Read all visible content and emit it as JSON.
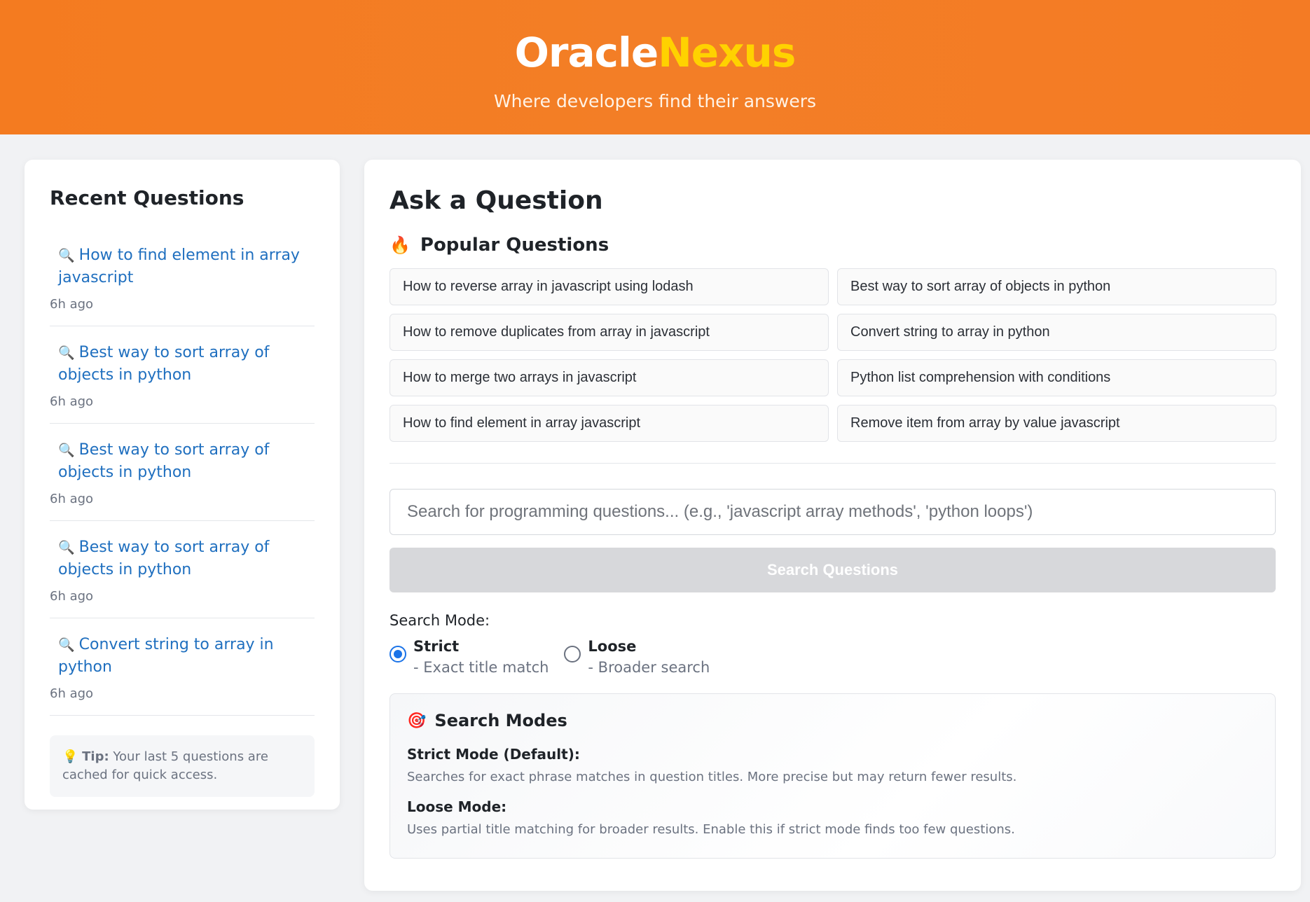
{
  "header": {
    "brand_part1": "Oracle",
    "brand_part2": "Nexus",
    "tagline": "Where developers find their answers"
  },
  "sidebar": {
    "title": "Recent Questions",
    "items": [
      {
        "label": "How to find element in array javascript",
        "time": "6h ago"
      },
      {
        "label": "Best way to sort array of objects in python",
        "time": "6h ago"
      },
      {
        "label": "Best way to sort array of objects in python",
        "time": "6h ago"
      },
      {
        "label": "Best way to sort array of objects in python",
        "time": "6h ago"
      },
      {
        "label": "Convert string to array in python",
        "time": "6h ago"
      }
    ],
    "tip_label": "Tip:",
    "tip_text": "Your last 5 questions are cached for quick access."
  },
  "main": {
    "title": "Ask a Question",
    "popular_title": "Popular Questions",
    "popular": [
      "How to reverse array in javascript using lodash",
      "Best way to sort array of objects in python",
      "How to remove duplicates from array in javascript",
      "Convert string to array in python",
      "How to merge two arrays in javascript",
      "Python list comprehension with conditions",
      "How to find element in array javascript",
      "Remove item from array by value javascript"
    ],
    "search_placeholder": "Search for programming questions... (e.g., 'javascript array methods', 'python loops')",
    "search_value": "",
    "search_button": "Search Questions",
    "mode_label": "Search Mode:",
    "modes": [
      {
        "name": "Strict",
        "desc": "- Exact title match",
        "selected": true
      },
      {
        "name": "Loose",
        "desc": "- Broader search",
        "selected": false
      }
    ],
    "info": {
      "title": "Search Modes",
      "strict_heading": "Strict Mode (Default):",
      "strict_text": "Searches for exact phrase matches in question titles. More precise but may return fewer results.",
      "loose_heading": "Loose Mode:",
      "loose_text": "Uses partial title matching for broader results. Enable this if strict mode finds too few questions."
    }
  },
  "colors": {
    "header_orange": "#f47b20",
    "brand_accent": "#ffd200",
    "link_blue": "#1f6fbf",
    "radio_blue": "#1a73e8",
    "button_disabled": "#d7d8db"
  },
  "icons": {
    "recent_item": "magnifier-icon",
    "popular": "fire-icon",
    "tip": "lightbulb-icon",
    "info": "target-icon"
  }
}
